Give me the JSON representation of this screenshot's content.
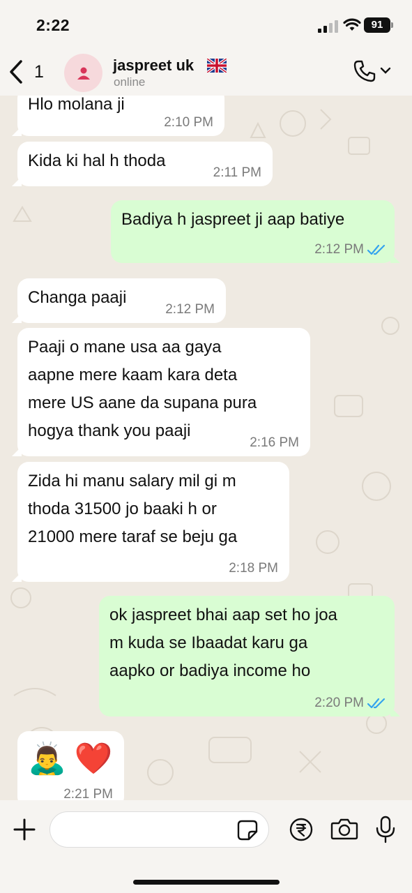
{
  "status_bar": {
    "time": "2:22",
    "battery": "91"
  },
  "header": {
    "back_count": "1",
    "contact_name": "jaspreet uk",
    "contact_status": "online"
  },
  "messages": [
    {
      "direction": "in",
      "lines": [
        "Hlo molana ji"
      ],
      "time": "2:10 PM"
    },
    {
      "direction": "in",
      "lines": [
        "Kida ki hal h thoda"
      ],
      "time": "2:11 PM"
    },
    {
      "direction": "out",
      "lines": [
        "Badiya h jaspreet ji aap batiye"
      ],
      "time": "2:12 PM",
      "status": "read"
    },
    {
      "direction": "in",
      "lines": [
        "Changa paaji"
      ],
      "time": "2:12 PM"
    },
    {
      "direction": "in",
      "lines": [
        "Paaji o mane usa aa gaya",
        "aapne mere kaam kara deta",
        "mere US aane da supana pura",
        "hogya thank you paaji"
      ],
      "time": "2:16 PM"
    },
    {
      "direction": "in",
      "lines": [
        "Zida hi manu salary mil gi m",
        "thoda 31500 jo baaki h or",
        "21000 mere taraf se beju ga"
      ],
      "time": "2:18 PM"
    },
    {
      "direction": "out",
      "lines": [
        "ok jaspreet bhai aap set ho joa",
        "m kuda se Ibaadat karu ga",
        "aapko or badiya income ho"
      ],
      "time": "2:20 PM",
      "status": "read"
    },
    {
      "direction": "in",
      "emoji": [
        "🙇‍♂️",
        "❤️"
      ],
      "time": "2:21 PM"
    }
  ],
  "composer": {
    "placeholder": ""
  },
  "icons": {
    "back": "chevron-left-icon",
    "avatar": "person-icon",
    "flag": "uk-flag-icon",
    "call": "phone-icon",
    "read_receipt": "double-check-icon",
    "attach": "plus-icon",
    "sticker": "sticker-icon",
    "payment": "rupee-icon",
    "camera": "camera-icon",
    "voice": "microphone-icon"
  },
  "colors": {
    "incoming_bubble": "#ffffff",
    "outgoing_bubble": "#d9fdd3",
    "read_tick": "#34a3ee",
    "avatar_bg": "#f6d9dc",
    "avatar_fg": "#d8365a"
  }
}
